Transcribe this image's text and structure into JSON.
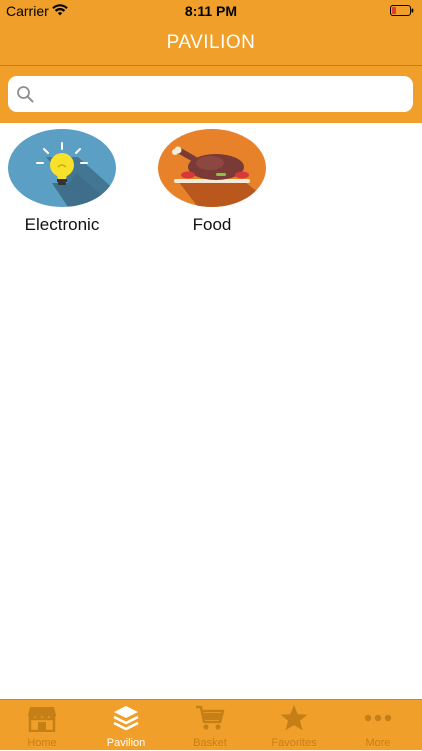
{
  "status_bar": {
    "carrier": "Carrier",
    "time": "8:11 PM",
    "battery_color": "#e53935"
  },
  "nav": {
    "title": "PAVILION"
  },
  "search": {
    "placeholder": "",
    "value": ""
  },
  "categories": [
    {
      "label": "Electronic",
      "icon": "lightbulb-icon",
      "color": "#5b9fc4"
    },
    {
      "label": "Food",
      "icon": "roast-chicken-icon",
      "color": "#e8822a"
    }
  ],
  "tabs": [
    {
      "label": "Home",
      "icon": "store-icon",
      "active": false
    },
    {
      "label": "Pavilion",
      "icon": "layers-icon",
      "active": true
    },
    {
      "label": "Basket",
      "icon": "cart-icon",
      "active": false
    },
    {
      "label": "Favorites",
      "icon": "star-icon",
      "active": false
    },
    {
      "label": "More",
      "icon": "more-icon",
      "active": false
    }
  ],
  "colors": {
    "accent": "#f0a02a",
    "inactive_tab": "#c67f16",
    "active_tab": "#ffffff"
  }
}
